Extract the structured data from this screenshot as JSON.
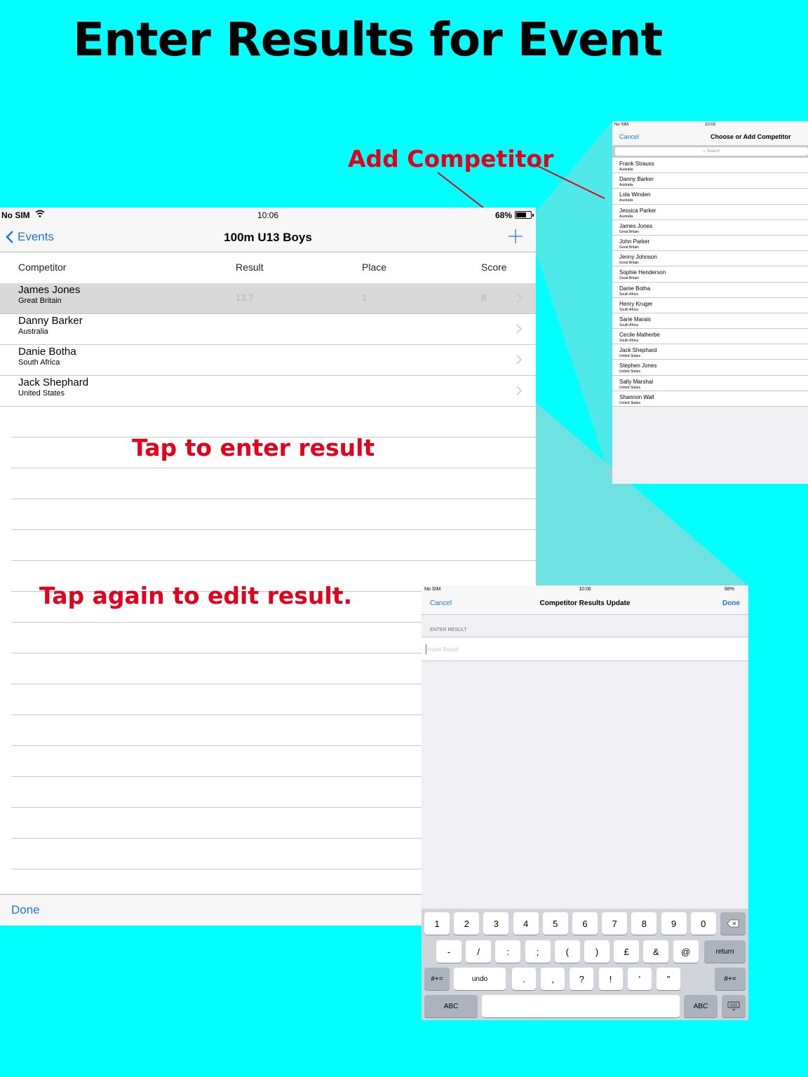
{
  "poster": {
    "title": "Enter Results for Event",
    "callouts": {
      "add_competitor": "Add Competitor",
      "tap_enter": "Tap to enter result",
      "tap_again": "Tap again to edit result."
    }
  },
  "main": {
    "status": {
      "carrier": "No SIM",
      "time": "10:06",
      "battery": "68%"
    },
    "nav": {
      "back_label": "Events",
      "title": "100m U13 Boys"
    },
    "columns": {
      "competitor": "Competitor",
      "result": "Result",
      "place": "Place",
      "score": "Score"
    },
    "rows": [
      {
        "name": "James Jones",
        "country": "Great Britain",
        "result": "13.7",
        "place": "1",
        "score": "8"
      },
      {
        "name": "Danny Barker",
        "country": "Australia",
        "result": "",
        "place": "",
        "score": ""
      },
      {
        "name": "Danie Botha",
        "country": "South Africa",
        "result": "",
        "place": "",
        "score": ""
      },
      {
        "name": "Jack Shephard",
        "country": "United States",
        "result": "",
        "place": "",
        "score": ""
      }
    ],
    "toolbar": {
      "done_label": "Done"
    }
  },
  "choose": {
    "status": {
      "carrier": "No SIM",
      "time": "10:03"
    },
    "nav": {
      "cancel": "Cancel",
      "title": "Choose or Add Competitor"
    },
    "search_placeholder": "Search",
    "items": [
      {
        "name": "Frank Strauss",
        "country": "Australia"
      },
      {
        "name": "Danny Barker",
        "country": "Australia"
      },
      {
        "name": "Lola Winden",
        "country": "Australia"
      },
      {
        "name": "Jessica Parker",
        "country": "Australia"
      },
      {
        "name": "James Jones",
        "country": "Great Britain"
      },
      {
        "name": "John Parker",
        "country": "Great Britain"
      },
      {
        "name": "Jenny Johnson",
        "country": "Great Britain"
      },
      {
        "name": "Sophie Henderson",
        "country": "Great Britain"
      },
      {
        "name": "Danie Botha",
        "country": "South Africa"
      },
      {
        "name": "Henry Kruger",
        "country": "South Africa"
      },
      {
        "name": "Sarie Marais",
        "country": "South Africa"
      },
      {
        "name": "Cecile Malherbe",
        "country": "South Africa"
      },
      {
        "name": "Jack Shephard",
        "country": "United States"
      },
      {
        "name": "Stephen Jones",
        "country": "United States"
      },
      {
        "name": "Sally Marshal",
        "country": "United States"
      },
      {
        "name": "Shannon Wall",
        "country": "United States"
      }
    ]
  },
  "update": {
    "status": {
      "carrier": "No SIM",
      "time": "10:06",
      "battery": "68%"
    },
    "nav": {
      "cancel": "Cancel",
      "title": "Competitor Results Update",
      "done": "Done"
    },
    "section_header": "ENTER RESULT",
    "placeholder": "Insert Result",
    "keyboard": {
      "row1": [
        "1",
        "2",
        "3",
        "4",
        "5",
        "6",
        "7",
        "8",
        "9",
        "0"
      ],
      "row2": [
        "-",
        "/",
        ":",
        ";",
        "(",
        ")",
        "£",
        "&",
        "@"
      ],
      "return_label": "return",
      "symbols_label": "#+=",
      "undo_label": "undo",
      "row3": [
        ".",
        ",",
        "?",
        "!",
        "’",
        "”"
      ],
      "abc_label": "ABC"
    }
  },
  "colors": {
    "accent": "#1e74e8",
    "callout": "#e4001b",
    "background": "#00ffff"
  }
}
